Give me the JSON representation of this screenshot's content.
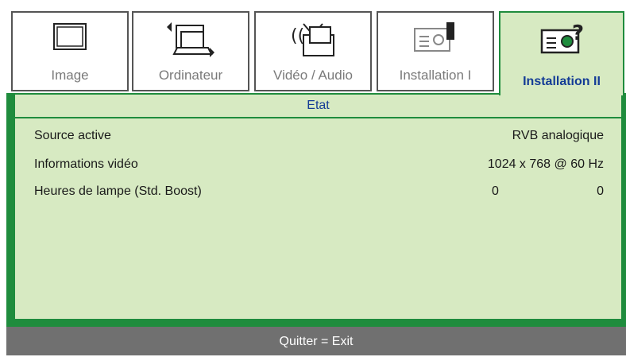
{
  "tabs": [
    {
      "label": "Image",
      "icon": "screen-icon",
      "active": false
    },
    {
      "label": "Ordinateur",
      "icon": "laptop-icon",
      "active": false
    },
    {
      "label": "Vidéo / Audio",
      "icon": "tv-antenna-icon",
      "active": false
    },
    {
      "label": "Installation I",
      "icon": "projector-icon",
      "active": false
    },
    {
      "label": "Installation II",
      "icon": "projector-help-icon",
      "active": true
    }
  ],
  "section": {
    "title": "Etat"
  },
  "rows": [
    {
      "label": "Source active",
      "value": "RVB analogique"
    },
    {
      "label": "Informations vidéo",
      "value": "1024 x 768  @ 60 Hz"
    },
    {
      "label": "Heures de lampe (Std. Boost)",
      "value_std": "0",
      "value_boost": "0"
    }
  ],
  "footer": {
    "text": "Quitter = Exit"
  },
  "colors": {
    "frame": "#1f8c3d",
    "panel": "#d7eac2",
    "active_text": "#143c96",
    "footer": "#707070"
  }
}
